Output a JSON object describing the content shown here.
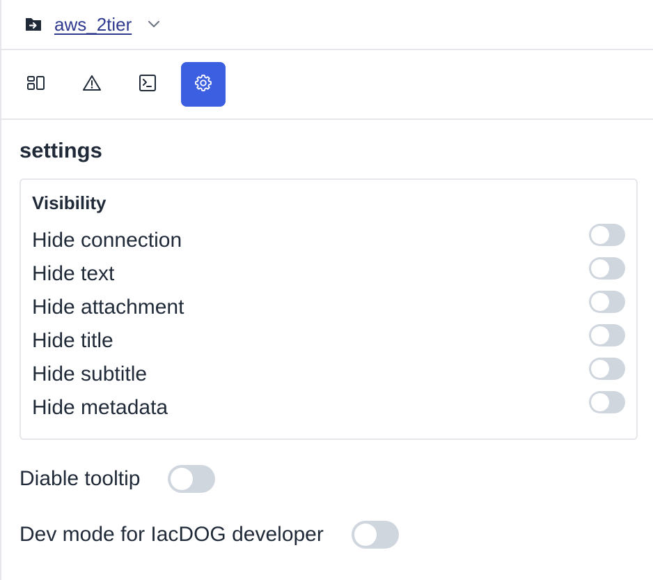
{
  "header": {
    "project_name": "aws_2tier",
    "project_icon": "folder-arrow-icon",
    "dropdown_icon": "chevron-down-icon"
  },
  "toolbar": {
    "buttons": [
      {
        "icon": "layout-icon",
        "active": false
      },
      {
        "icon": "warning-icon",
        "active": false
      },
      {
        "icon": "terminal-icon",
        "active": false
      },
      {
        "icon": "gear-icon",
        "active": true
      }
    ],
    "active_color": "#3b5fe0"
  },
  "settings": {
    "title": "settings",
    "visibility": {
      "title": "Visibility",
      "items": [
        {
          "label": "Hide connection",
          "on": false
        },
        {
          "label": "Hide text",
          "on": false
        },
        {
          "label": "Hide attachment",
          "on": false
        },
        {
          "label": "Hide title",
          "on": false
        },
        {
          "label": "Hide subtitle",
          "on": false
        },
        {
          "label": "Hide metadata",
          "on": false
        }
      ]
    },
    "disable_tooltip": {
      "label": "Diable tooltip",
      "on": false
    },
    "dev_mode": {
      "label": "Dev mode for IacDOG developer",
      "on": false
    }
  }
}
